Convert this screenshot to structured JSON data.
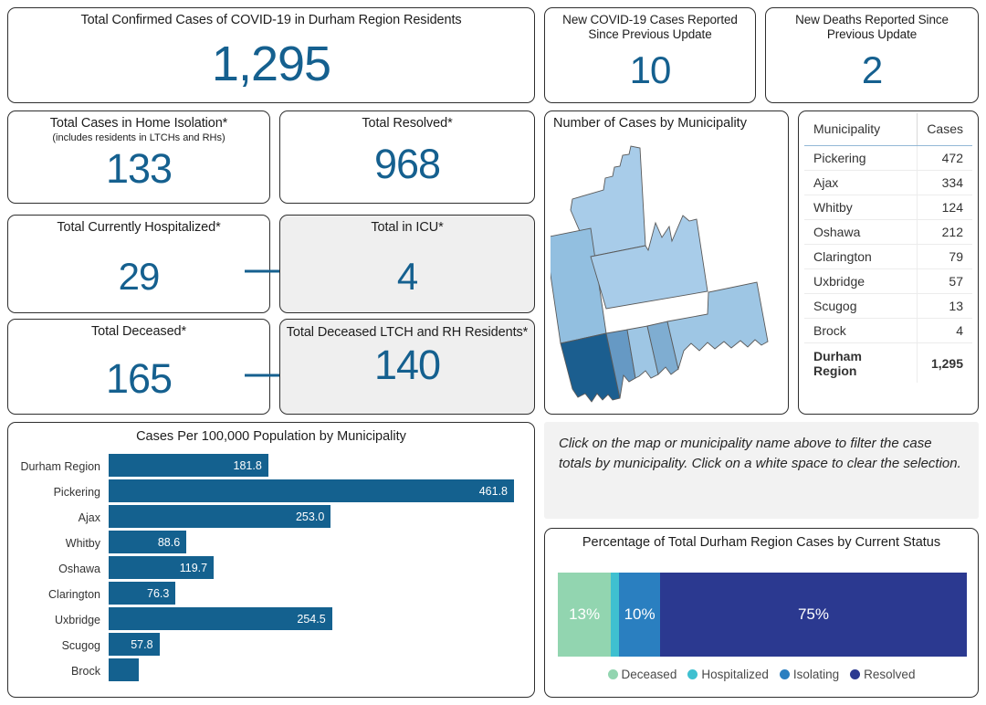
{
  "kpis": {
    "total_confirmed": {
      "title": "Total Confirmed Cases of COVID-19 in Durham Region Residents",
      "value": "1,295"
    },
    "new_cases": {
      "title": "New COVID-19 Cases Reported Since Previous Update",
      "value": "10"
    },
    "new_deaths": {
      "title": "New Deaths Reported Since Previous Update",
      "value": "2"
    },
    "home_isolation": {
      "title": "Total Cases in Home Isolation*",
      "subtitle": "(includes residents in LTCHs and RHs)",
      "value": "133"
    },
    "resolved": {
      "title": "Total Resolved*",
      "value": "968"
    },
    "hospitalized": {
      "title": "Total Currently Hospitalized*",
      "value": "29"
    },
    "icu": {
      "title": "Total in ICU*",
      "value": "4"
    },
    "deceased": {
      "title": "Total Deceased*",
      "value": "165"
    },
    "deceased_ltch": {
      "title": "Total Deceased LTCH and RH Residents*",
      "value": "140"
    }
  },
  "map_panel": {
    "title": "Number of Cases by Municipality",
    "regions": [
      {
        "name": "Brock",
        "fill": "#a8cce9"
      },
      {
        "name": "Uxbridge",
        "fill": "#92bfe0"
      },
      {
        "name": "Scugog",
        "fill": "#a8cce9"
      },
      {
        "name": "Pickering",
        "fill": "#1b5e8f"
      },
      {
        "name": "Ajax",
        "fill": "#6699c4"
      },
      {
        "name": "Whitby",
        "fill": "#9ec6e4"
      },
      {
        "name": "Oshawa",
        "fill": "#7fadd1"
      },
      {
        "name": "Clarington",
        "fill": "#9ec6e4"
      }
    ]
  },
  "table": {
    "headers": {
      "municipality": "Municipality",
      "cases": "Cases"
    },
    "rows": [
      {
        "municipality": "Pickering",
        "cases": "472"
      },
      {
        "municipality": "Ajax",
        "cases": "334"
      },
      {
        "municipality": "Whitby",
        "cases": "124"
      },
      {
        "municipality": "Oshawa",
        "cases": "212"
      },
      {
        "municipality": "Clarington",
        "cases": "79"
      },
      {
        "municipality": "Uxbridge",
        "cases": "57"
      },
      {
        "municipality": "Scugog",
        "cases": "13"
      },
      {
        "municipality": "Brock",
        "cases": "4"
      }
    ],
    "total_row": {
      "municipality": "Durham Region",
      "cases": "1,295"
    }
  },
  "instructions": {
    "text": "Click on the map or municipality name above to filter the case totals by municipality. Click on a white space to clear the selection."
  },
  "colors": {
    "accent_blue": "#15608f",
    "bar_blue": "#14618f",
    "deceased": "#92d5b0",
    "hospitalized": "#3fc0d0",
    "isolating": "#2a7fc0",
    "resolved": "#2b3990",
    "card_border": "#2e2e2e",
    "grey_card": "#efefef"
  },
  "chart_data": [
    {
      "type": "bar",
      "orientation": "horizontal",
      "title": "Cases Per 100,000 Population by Municipality",
      "xlabel": "",
      "ylabel": "",
      "categories": [
        "Durham Region",
        "Pickering",
        "Ajax",
        "Whitby",
        "Oshawa",
        "Clarington",
        "Uxbridge",
        "Scugog",
        "Brock"
      ],
      "values": [
        181.8,
        461.8,
        253.0,
        88.6,
        119.7,
        76.3,
        254.5,
        57.8,
        34.3
      ],
      "labels": [
        "181.8",
        "461.8",
        "253.0",
        "88.6",
        "119.7",
        "76.3",
        "254.5",
        "57.8",
        ""
      ],
      "xlim": [
        0,
        461.8
      ],
      "grid": false,
      "legend": "none",
      "series_color": "#14618f"
    },
    {
      "type": "bar",
      "orientation": "horizontal-stacked-100",
      "title": "Percentage of Total Durham Region Cases by Current Status",
      "categories": [
        "Deceased",
        "Hospitalized",
        "Isolating",
        "Resolved"
      ],
      "values": [
        13,
        2,
        10,
        75
      ],
      "labels": [
        "13%",
        "",
        "10%",
        "75%"
      ],
      "colors": [
        "#92d5b0",
        "#3fc0d0",
        "#2a7fc0",
        "#2b3990"
      ],
      "legend": "bottom",
      "legend_entries": [
        "Deceased",
        "Hospitalized",
        "Isolating",
        "Resolved"
      ]
    }
  ]
}
